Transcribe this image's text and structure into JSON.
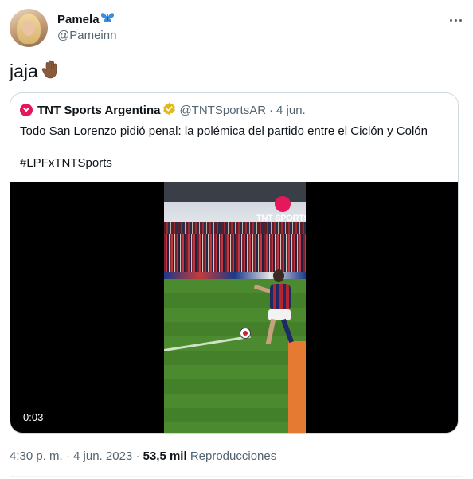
{
  "tweet": {
    "author_name": "Pamela",
    "author_handle": "@Pameinn",
    "text": "jaja",
    "timestamp": "4:30 p. m. · 4 jun. 2023",
    "separator": "·",
    "views_count": "53,5 mil",
    "views_label": "Reproducciones"
  },
  "quoted": {
    "author_name": "TNT Sports Argentina",
    "author_handle": "@TNTSportsAR",
    "separator": "·",
    "date": "4 jun.",
    "text_line1": "Todo San Lorenzo pidió penal: la polémica del partido entre el Ciclón y Colón",
    "text_line2": "#LPFxTNTSports",
    "video_duration": "0:03",
    "video_watermark": "TNT SPORTS"
  },
  "icons": {
    "name_emoji": "butterfly-icon",
    "text_emoji": "raised-hand-icon",
    "more": "more-options-icon",
    "verified": "verified-badge-icon"
  },
  "colors": {
    "text_primary": "#0f1419",
    "text_secondary": "#536471",
    "border": "#cfd9de",
    "verified_gold": "#e2b719",
    "tnt_pink": "#e4185b"
  }
}
